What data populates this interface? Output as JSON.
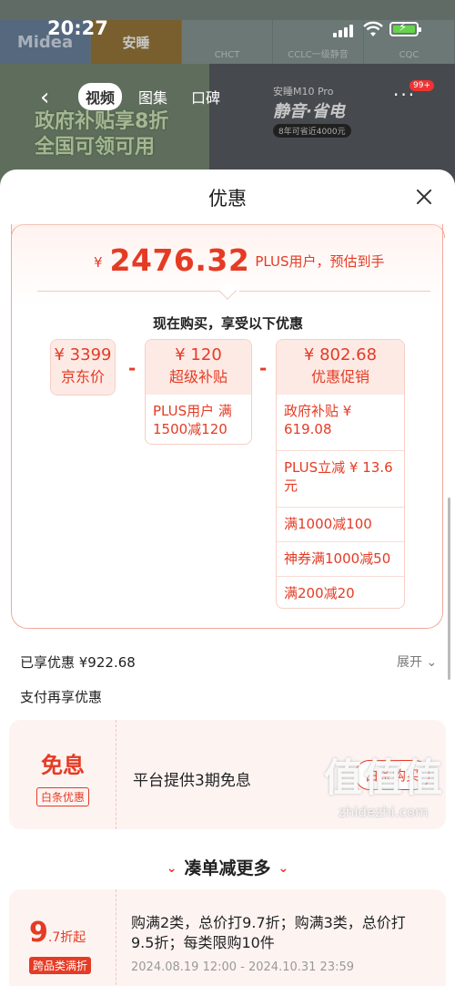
{
  "status_bar": {
    "time": "20:27"
  },
  "background": {
    "certs": [
      "Midea",
      "安睡",
      "CHCT",
      "CCLC一级静音",
      "CQC"
    ],
    "promo_line1": "政府补贴享8折",
    "promo_line2": "全国可领可用",
    "product_name": "安睡M10 Pro",
    "product_slogan": "静音·省电",
    "product_tag": "8年可省近4000元",
    "nav_tabs": [
      "视频",
      "图集",
      "口碑"
    ],
    "nav_badge": "99+"
  },
  "sheet": {
    "title": "优惠",
    "price": {
      "currency": "¥",
      "amount": "2476.32",
      "note": "PLUS用户，预估到手"
    },
    "subhead": "现在购买，享受以下优惠",
    "breakdown": {
      "jd_price": {
        "amount": "¥ 3399",
        "label": "京东价"
      },
      "super_subsidy": {
        "amount": "¥ 120",
        "label": "超级补贴",
        "items": [
          "PLUS用户 满1500减120"
        ]
      },
      "promotion": {
        "amount": "¥ 802.68",
        "label": "优惠促销",
        "items": [
          "政府补贴 ¥ 619.08",
          "PLUS立减 ¥ 13.6元",
          "满1000减100",
          "神券满1000减50",
          "满200减20"
        ]
      }
    },
    "saved_text": "已享优惠 ¥922.68",
    "expand_label": "展开",
    "pay_title": "支付再享优惠",
    "coupon": {
      "big": "免息",
      "tag": "白条优惠",
      "desc": "平台提供3期免息",
      "button": "白条购买"
    },
    "more_title": "凑单减更多",
    "deal": {
      "rate": "9",
      "rate_unit": ".7折起",
      "tag": "跨品类满折",
      "text": "购满2类，总价打9.7折；购满3类，总价打9.5折；每类限购10件",
      "date": "2024.08.19 12:00 - 2024.10.31 23:59"
    }
  },
  "watermark": {
    "text": "值值值",
    "url": "zhidezhi.com"
  },
  "colors": {
    "accent": "#e53b24",
    "card_bg": "#fdf4f2"
  }
}
